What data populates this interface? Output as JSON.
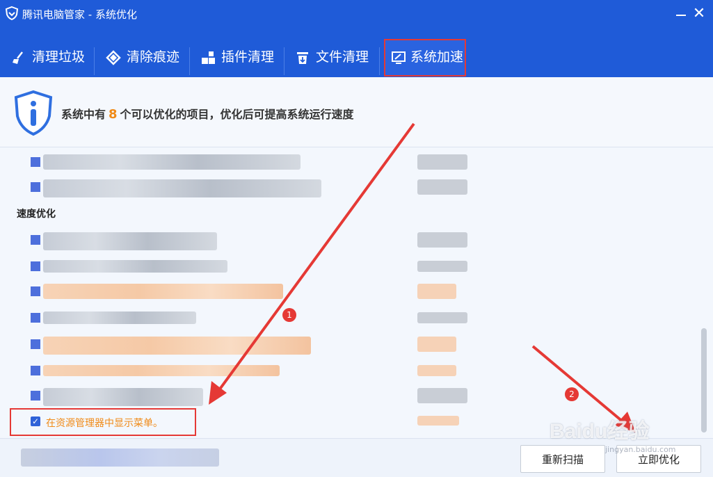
{
  "window": {
    "title": "腾讯电脑管家 - 系统优化",
    "minimize_label": "",
    "close_label": "✕"
  },
  "tabs": [
    {
      "label": "清理垃圾",
      "icon": "broom-icon"
    },
    {
      "label": "清除痕迹",
      "icon": "eraser-icon"
    },
    {
      "label": "插件清理",
      "icon": "plugin-icon"
    },
    {
      "label": "文件清理",
      "icon": "file-trash-icon"
    },
    {
      "label": "系统加速",
      "icon": "monitor-speed-icon",
      "active": true
    }
  ],
  "banner": {
    "prefix": "系统中有",
    "count": "8",
    "suffix": "个可以优化的项目，优化后可提高系统运行速度"
  },
  "list": {
    "section_title": "速度优化",
    "checked_item_label": "在资源管理器中显示菜单。",
    "checkbox_mark": "✓"
  },
  "footer": {
    "rescan_label": "重新扫描",
    "optimize_label": "立即优化"
  },
  "annotations": {
    "marker_1": "1",
    "marker_2": "2"
  },
  "watermark": {
    "text": "Baidu经验",
    "sub": "jingyan.baidu.com"
  },
  "colors": {
    "brand_blue": "#1f5bd8",
    "accent_orange": "#f08a17",
    "highlight_red": "#e53935"
  }
}
